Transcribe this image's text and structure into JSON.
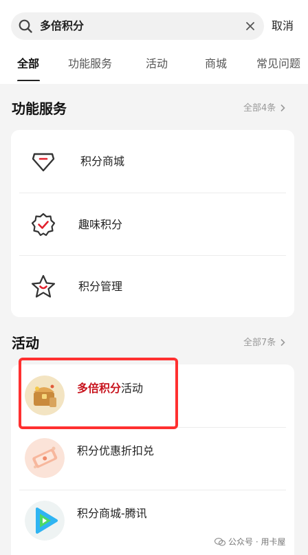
{
  "search": {
    "query": "多倍积分",
    "cancel_label": "取消"
  },
  "tabs": [
    {
      "label": "全部",
      "active": true
    },
    {
      "label": "功能服务",
      "active": false
    },
    {
      "label": "活动",
      "active": false
    },
    {
      "label": "商城",
      "active": false
    },
    {
      "label": "常见问题",
      "active": false
    }
  ],
  "services": {
    "title": "功能服务",
    "more": "全部4条",
    "items": [
      {
        "label": "积分商城",
        "icon": "gem-icon"
      },
      {
        "label": "趣味积分",
        "icon": "badge-check-icon"
      },
      {
        "label": "积分管理",
        "icon": "star-smile-icon"
      }
    ]
  },
  "activities": {
    "title": "活动",
    "more": "全部7条",
    "items": [
      {
        "highlight": "多倍积分",
        "rest": "活动",
        "icon": "treasure-chest-icon"
      },
      {
        "highlight": "",
        "rest": "积分优惠折扣兑",
        "icon": "sale-ticket-icon"
      },
      {
        "highlight": "",
        "rest": "积分商城-腾讯",
        "icon": "tencent-video-icon"
      }
    ]
  },
  "watermark": "公众号 · 用卡屋",
  "colors": {
    "accent_red": "#c8141e",
    "highlight_box": "#ff3030",
    "background": "#f4f4f4"
  }
}
